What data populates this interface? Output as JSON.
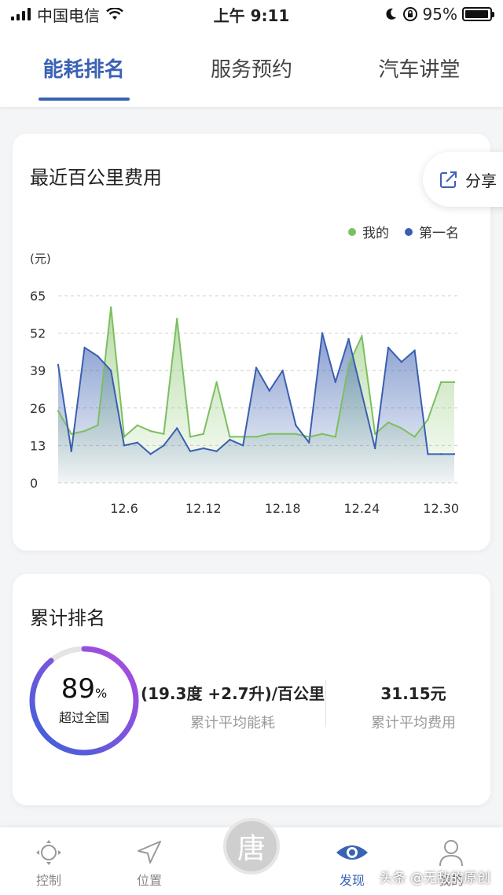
{
  "status_bar": {
    "carrier": "中国电信",
    "time": "上午 9:11",
    "battery": "95%",
    "battery_level": 0.95
  },
  "top_tabs": [
    {
      "label": "能耗排名",
      "active": true
    },
    {
      "label": "服务预约",
      "active": false
    },
    {
      "label": "汽车讲堂",
      "active": false
    }
  ],
  "chart_card": {
    "title": "最近百公里费用",
    "share_label": "分享",
    "unit": "(元)"
  },
  "chart_data": {
    "type": "area",
    "title": "最近百公里费用",
    "ylabel": "(元)",
    "ylim": [
      0,
      65
    ],
    "yticks": [
      0,
      13,
      26,
      39,
      52,
      65
    ],
    "grid": true,
    "legend_position": "top-right",
    "x": [
      "12.1",
      "12.2",
      "12.3",
      "12.4",
      "12.5",
      "12.6",
      "12.7",
      "12.8",
      "12.9",
      "12.10",
      "12.11",
      "12.12",
      "12.13",
      "12.14",
      "12.15",
      "12.16",
      "12.17",
      "12.18",
      "12.19",
      "12.20",
      "12.21",
      "12.22",
      "12.23",
      "12.24",
      "12.25",
      "12.26",
      "12.27",
      "12.28",
      "12.29",
      "12.30",
      "12.31"
    ],
    "xticks": [
      "12.6",
      "12.12",
      "12.18",
      "12.24",
      "12.30"
    ],
    "series": [
      {
        "name": "我的",
        "color": "#7cbf5f",
        "values": [
          25,
          17,
          18,
          20,
          61,
          16,
          20,
          18,
          17,
          57,
          16,
          17,
          35,
          16,
          16,
          16,
          17,
          17,
          17,
          16,
          17,
          16,
          41,
          51,
          17,
          21,
          19,
          16,
          22,
          35,
          35
        ]
      },
      {
        "name": "第一名",
        "color": "#3a5fb0",
        "values": [
          41,
          11,
          47,
          44,
          39,
          13,
          14,
          10,
          13,
          19,
          11,
          12,
          11,
          15,
          13,
          40,
          32,
          39,
          20,
          14,
          52,
          35,
          50,
          31,
          12,
          47,
          42,
          46,
          10,
          10,
          10
        ]
      }
    ]
  },
  "rank_card": {
    "title": "累计排名",
    "percent": "89",
    "percent_sign": "%",
    "percent_value": 89,
    "ring_caption": "超过全国",
    "stat1_value": "(19.3度 +2.7升)/百公里",
    "stat1_caption": "累计平均能耗",
    "stat2_value": "31.15元",
    "stat2_caption": "累计平均费用"
  },
  "bottom_nav": {
    "items": [
      {
        "label": "控制",
        "icon": "joystick-icon"
      },
      {
        "label": "位置",
        "icon": "location-arrow-icon"
      },
      {
        "label": "发现",
        "icon": "eye-icon",
        "active": true
      },
      {
        "label": "我的",
        "icon": "person-icon"
      }
    ],
    "center_glyph": "唐"
  },
  "watermark": "头条 @无敌的原创"
}
